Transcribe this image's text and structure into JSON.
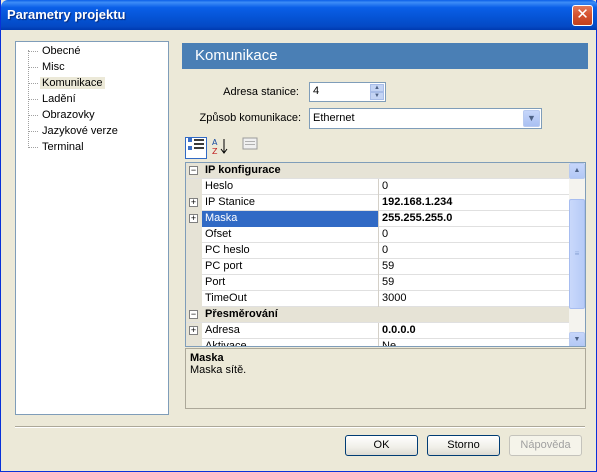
{
  "window": {
    "title": "Parametry projektu"
  },
  "tree": {
    "items": [
      "Obecné",
      "Misc",
      "Komunikace",
      "Ladění",
      "Obrazovky",
      "Jazykové verze",
      "Terminal"
    ]
  },
  "section": {
    "title": "Komunikace"
  },
  "form": {
    "address_label": "Adresa stanice:",
    "address_value": "4",
    "comm_label": "Způsob komunikace:",
    "comm_value": "Ethernet"
  },
  "grid": {
    "rows": [
      {
        "type": "cat",
        "name": "IP konfigurace"
      },
      {
        "type": "prop",
        "name": "Heslo",
        "value": "0"
      },
      {
        "type": "prop",
        "name": "IP Stanice",
        "value": "192.168.1.234",
        "expand": true,
        "bold": true
      },
      {
        "type": "prop",
        "name": "Maska",
        "value": "255.255.255.0",
        "expand": true,
        "bold": true,
        "selected": true
      },
      {
        "type": "prop",
        "name": "Ofset",
        "value": "0"
      },
      {
        "type": "prop",
        "name": "PC heslo",
        "value": "0"
      },
      {
        "type": "prop",
        "name": "PC port",
        "value": "59"
      },
      {
        "type": "prop",
        "name": "Port",
        "value": "59"
      },
      {
        "type": "prop",
        "name": "TimeOut",
        "value": "3000"
      },
      {
        "type": "cat",
        "name": "Přesměrování"
      },
      {
        "type": "prop",
        "name": "Adresa",
        "value": "0.0.0.0",
        "expand": true,
        "bold": true
      },
      {
        "type": "prop",
        "name": "Aktivace",
        "value": "Ne"
      }
    ]
  },
  "description": {
    "title": "Maska",
    "text": "Maska sítě."
  },
  "buttons": {
    "ok": "OK",
    "cancel": "Storno",
    "help": "Nápověda"
  }
}
